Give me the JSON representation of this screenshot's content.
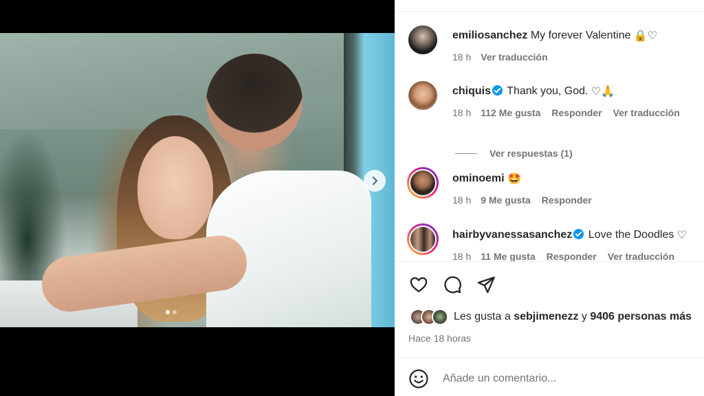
{
  "post": {
    "time_ago": "Hace 18 horas",
    "likes": {
      "prefix": "Les gusta a",
      "user": "sebjimenezz",
      "conj": "y",
      "others": "9406 personas más"
    }
  },
  "caption": {
    "user": "emiliosanchez",
    "text": "My forever Valentine",
    "emoji": "🔒♡",
    "time": "18 h",
    "translate": "Ver traducción"
  },
  "comments": [
    {
      "user": "chiquis",
      "verified": true,
      "text": "Thank you, God.",
      "emoji": "♡🙏",
      "time": "18 h",
      "likes": "112 Me gusta",
      "reply": "Responder",
      "translate": "Ver traducción"
    },
    {
      "user": "ominoemi",
      "verified": false,
      "text": "",
      "emoji": "🤩",
      "time": "18 h",
      "likes": "9 Me gusta",
      "reply": "Responder"
    },
    {
      "user": "hairbyvanessasanchez",
      "verified": true,
      "text": "Love the Doodles",
      "emoji": "♡",
      "time": "18 h",
      "likes": "11 Me gusta",
      "reply": "Responder",
      "translate": "Ver traducción"
    }
  ],
  "replies_link": "Ver respuestas (1)",
  "add_comment": {
    "placeholder": "Añade un comentario..."
  },
  "icons": {
    "like": "heart-icon",
    "comment": "comment-bubble-icon",
    "share": "paper-plane-icon",
    "emoji": "smiley-icon",
    "next": "chevron-right-icon"
  },
  "colors": {
    "verified": "#0095f6",
    "text": "#262626",
    "muted": "#737373"
  }
}
